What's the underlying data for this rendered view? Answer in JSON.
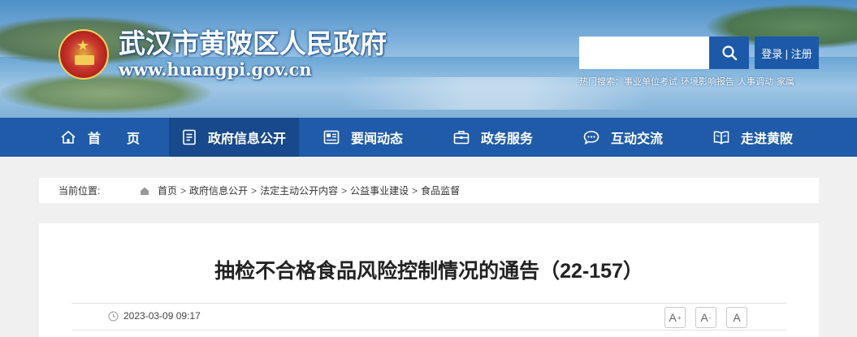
{
  "header": {
    "site_title": "武汉市黄陂区人民政府",
    "site_url": "www.huangpi.gov.cn",
    "search": {
      "value": "",
      "button_icon": "search-icon"
    },
    "login_label": "登录 | 注册",
    "hot_search": {
      "label": "热门搜索：",
      "items": [
        "事业单位考试",
        "环境影响报告",
        "人事调动",
        "家属"
      ]
    }
  },
  "nav": {
    "items": [
      {
        "label": "首　　页",
        "icon": "home-icon"
      },
      {
        "label": "政府信息公开",
        "icon": "document-icon",
        "active": true
      },
      {
        "label": "要闻动态",
        "icon": "news-icon"
      },
      {
        "label": "政务服务",
        "icon": "briefcase-icon"
      },
      {
        "label": "互动交流",
        "icon": "chat-icon"
      },
      {
        "label": "走进黄陂",
        "icon": "book-icon"
      }
    ]
  },
  "breadcrumb": {
    "label": "当前位置:",
    "items": [
      "首页",
      "政府信息公开",
      "法定主动公开内容",
      "公益事业建设",
      "食品监督"
    ],
    "separator": ">"
  },
  "article": {
    "title": "抽检不合格食品风险控制情况的通告（22-157）",
    "date": "2023-03-09 09:17",
    "font_buttons": [
      {
        "label": "A",
        "sup": "+"
      },
      {
        "label": "A",
        "sup": "-"
      },
      {
        "label": "A",
        "sup": ""
      }
    ]
  },
  "colors": {
    "nav_bg": "#1f5ba8",
    "nav_active": "#17498c",
    "button_blue": "#1c5aa9"
  }
}
